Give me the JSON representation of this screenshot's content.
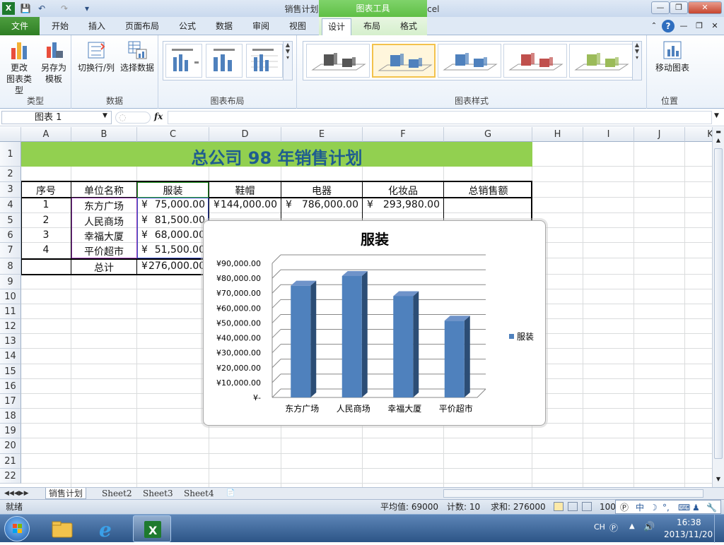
{
  "window": {
    "title": "销售计划1  [兼容模式] - Microsoft Excel",
    "context_tab_group": "图表工具"
  },
  "tabs": [
    "文件",
    "开始",
    "插入",
    "页面布局",
    "公式",
    "数据",
    "审阅",
    "视图",
    "设计",
    "布局",
    "格式"
  ],
  "active_tab": "设计",
  "ribbon": {
    "groups": {
      "type": {
        "label": "类型",
        "buttons": [
          "更改\n图表类型",
          "另存为\n模板"
        ]
      },
      "data": {
        "label": "数据",
        "buttons": [
          "切换行/列",
          "选择数据"
        ]
      },
      "layouts": {
        "label": "图表布局"
      },
      "styles": {
        "label": "图表样式"
      },
      "location": {
        "label": "位置",
        "buttons": [
          "移动图表"
        ]
      }
    },
    "type_b1_l1": "更改",
    "type_b1_l2": "图表类型",
    "type_b2_l1": "另存为",
    "type_b2_l2": "模板",
    "data_b1": "切换行/列",
    "data_b2": "选择数据",
    "loc_b1": "移动图表",
    "style_colors": [
      "#555555",
      "#4f81bd",
      "#4f81bd",
      "#c0504d",
      "#9bbb59"
    ]
  },
  "formula_bar": {
    "name_box": "图表 1",
    "fx": "fx",
    "formula": ""
  },
  "columns": [
    "A",
    "B",
    "C",
    "D",
    "E",
    "F",
    "G",
    "H",
    "I",
    "J",
    "K"
  ],
  "rows": [
    "1",
    "2",
    "3",
    "4",
    "5",
    "6",
    "7",
    "8",
    "9",
    "10",
    "11",
    "12",
    "13",
    "14",
    "15",
    "16",
    "17",
    "18",
    "19",
    "20",
    "21",
    "22"
  ],
  "sheet": {
    "title": "总公司  98  年销售计划",
    "headers": [
      "序号",
      "单位名称",
      "服装",
      "鞋帽",
      "电器",
      "化妆品",
      "总销售额"
    ],
    "r4": {
      "a": "1",
      "b": "东方广场",
      "c_sym": "¥",
      "c": "75,000.00",
      "d_sym": "¥",
      "d": "144,000.00",
      "e_sym": "¥",
      "e": "786,000.00",
      "f_sym": "¥",
      "f": "293,980.00"
    },
    "r5": {
      "a": "2",
      "b": "人民商场",
      "c_sym": "¥",
      "c": "81,500.00"
    },
    "r6": {
      "a": "3",
      "b": "幸福大厦",
      "c_sym": "¥",
      "c": "68,000.00"
    },
    "r7": {
      "a": "4",
      "b": "平价超市",
      "c_sym": "¥",
      "c": "51,500.00"
    },
    "r8": {
      "b": "总计",
      "c_sym": "¥",
      "c": "276,000.00"
    }
  },
  "chart_data": {
    "type": "bar",
    "title": "服装",
    "categories": [
      "东方广场",
      "人民商场",
      "幸福大厦",
      "平价超市"
    ],
    "series": [
      {
        "name": "服装",
        "values": [
          75000,
          81500,
          68000,
          51500
        ],
        "color": "#4f81bd"
      }
    ],
    "ylim": [
      0,
      90000
    ],
    "yticks": [
      "¥-",
      "¥10,000.00",
      "¥20,000.00",
      "¥30,000.00",
      "¥40,000.00",
      "¥50,000.00",
      "¥60,000.00",
      "¥70,000.00",
      "¥80,000.00",
      "¥90,000.00"
    ],
    "legend": "right",
    "grid": true
  },
  "sheet_tabs": [
    "销售计划",
    "Sheet2",
    "Sheet3",
    "Sheet4"
  ],
  "active_sheet": "销售计划",
  "status": {
    "mode": "就绪",
    "average": "平均值: 69000",
    "count": "计数: 10",
    "sum": "求和: 276000",
    "zoom": "100"
  },
  "ime": {
    "label": "中"
  },
  "taskbar": {
    "lang": "CH",
    "time": "16:38",
    "date": "2013/11/20"
  }
}
